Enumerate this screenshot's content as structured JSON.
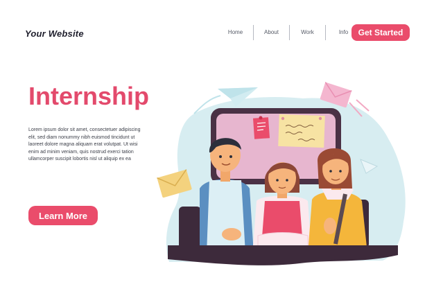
{
  "header": {
    "brand": "Your Website",
    "nav": [
      "Home",
      "About",
      "Work",
      "Info"
    ],
    "cta_label": "Get Started"
  },
  "hero": {
    "title": "Internship",
    "body": "Lorem ipsum dolor sit amet, consectetuer adipiscing elit, sed diam nonummy nibh euismod tincidunt ut laoreet dolore magna aliquam erat volutpat. Ut wisi enim ad minim veniam, quis nostrud exerci tation ullamcorper suscipit lobortis nisl ut aliquip ex ea",
    "button_label": "Learn More"
  },
  "colors": {
    "accent": "#ea4c6b",
    "title": "#e34a6c",
    "blob": "#d7edf1",
    "board_frame": "#4a3145",
    "board": "#e7b6cf"
  }
}
